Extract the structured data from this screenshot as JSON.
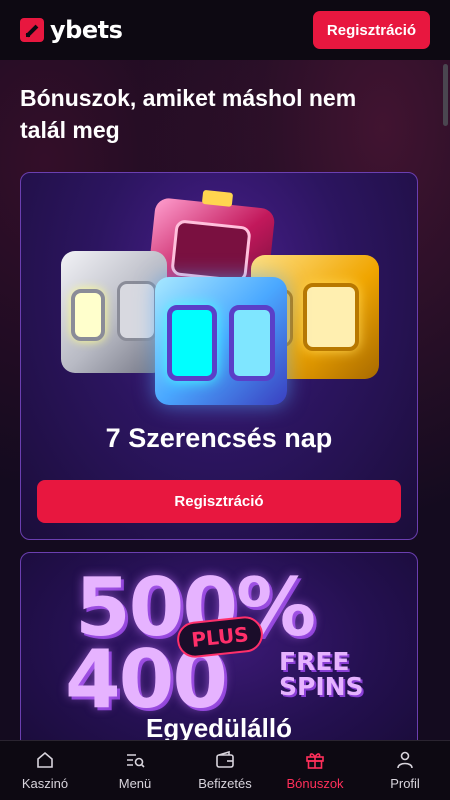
{
  "header": {
    "logo_text": "ybets",
    "register_label": "Regisztráció"
  },
  "main": {
    "title": "Bónuszok, amiket máshol nem talál meg",
    "cards": [
      {
        "title": "7 Szerencsés nap",
        "button_label": "Regisztráció"
      },
      {
        "promo_line1": "500%",
        "promo_badge": "PLUS",
        "promo_line2": "400",
        "promo_free": "FREE",
        "promo_spins": "SPINS",
        "title": "Egyedülálló"
      }
    ]
  },
  "bottom_nav": {
    "items": [
      {
        "label": "Kaszinó",
        "icon": "home-icon"
      },
      {
        "label": "Menü",
        "icon": "menu-search-icon"
      },
      {
        "label": "Befizetés",
        "icon": "wallet-icon"
      },
      {
        "label": "Bónuszok",
        "icon": "gift-icon"
      },
      {
        "label": "Profil",
        "icon": "user-icon"
      }
    ],
    "active_index": 3
  },
  "colors": {
    "accent": "#e8173f",
    "active_nav": "#ff2f5a",
    "card_border": "#6b3fb0"
  }
}
